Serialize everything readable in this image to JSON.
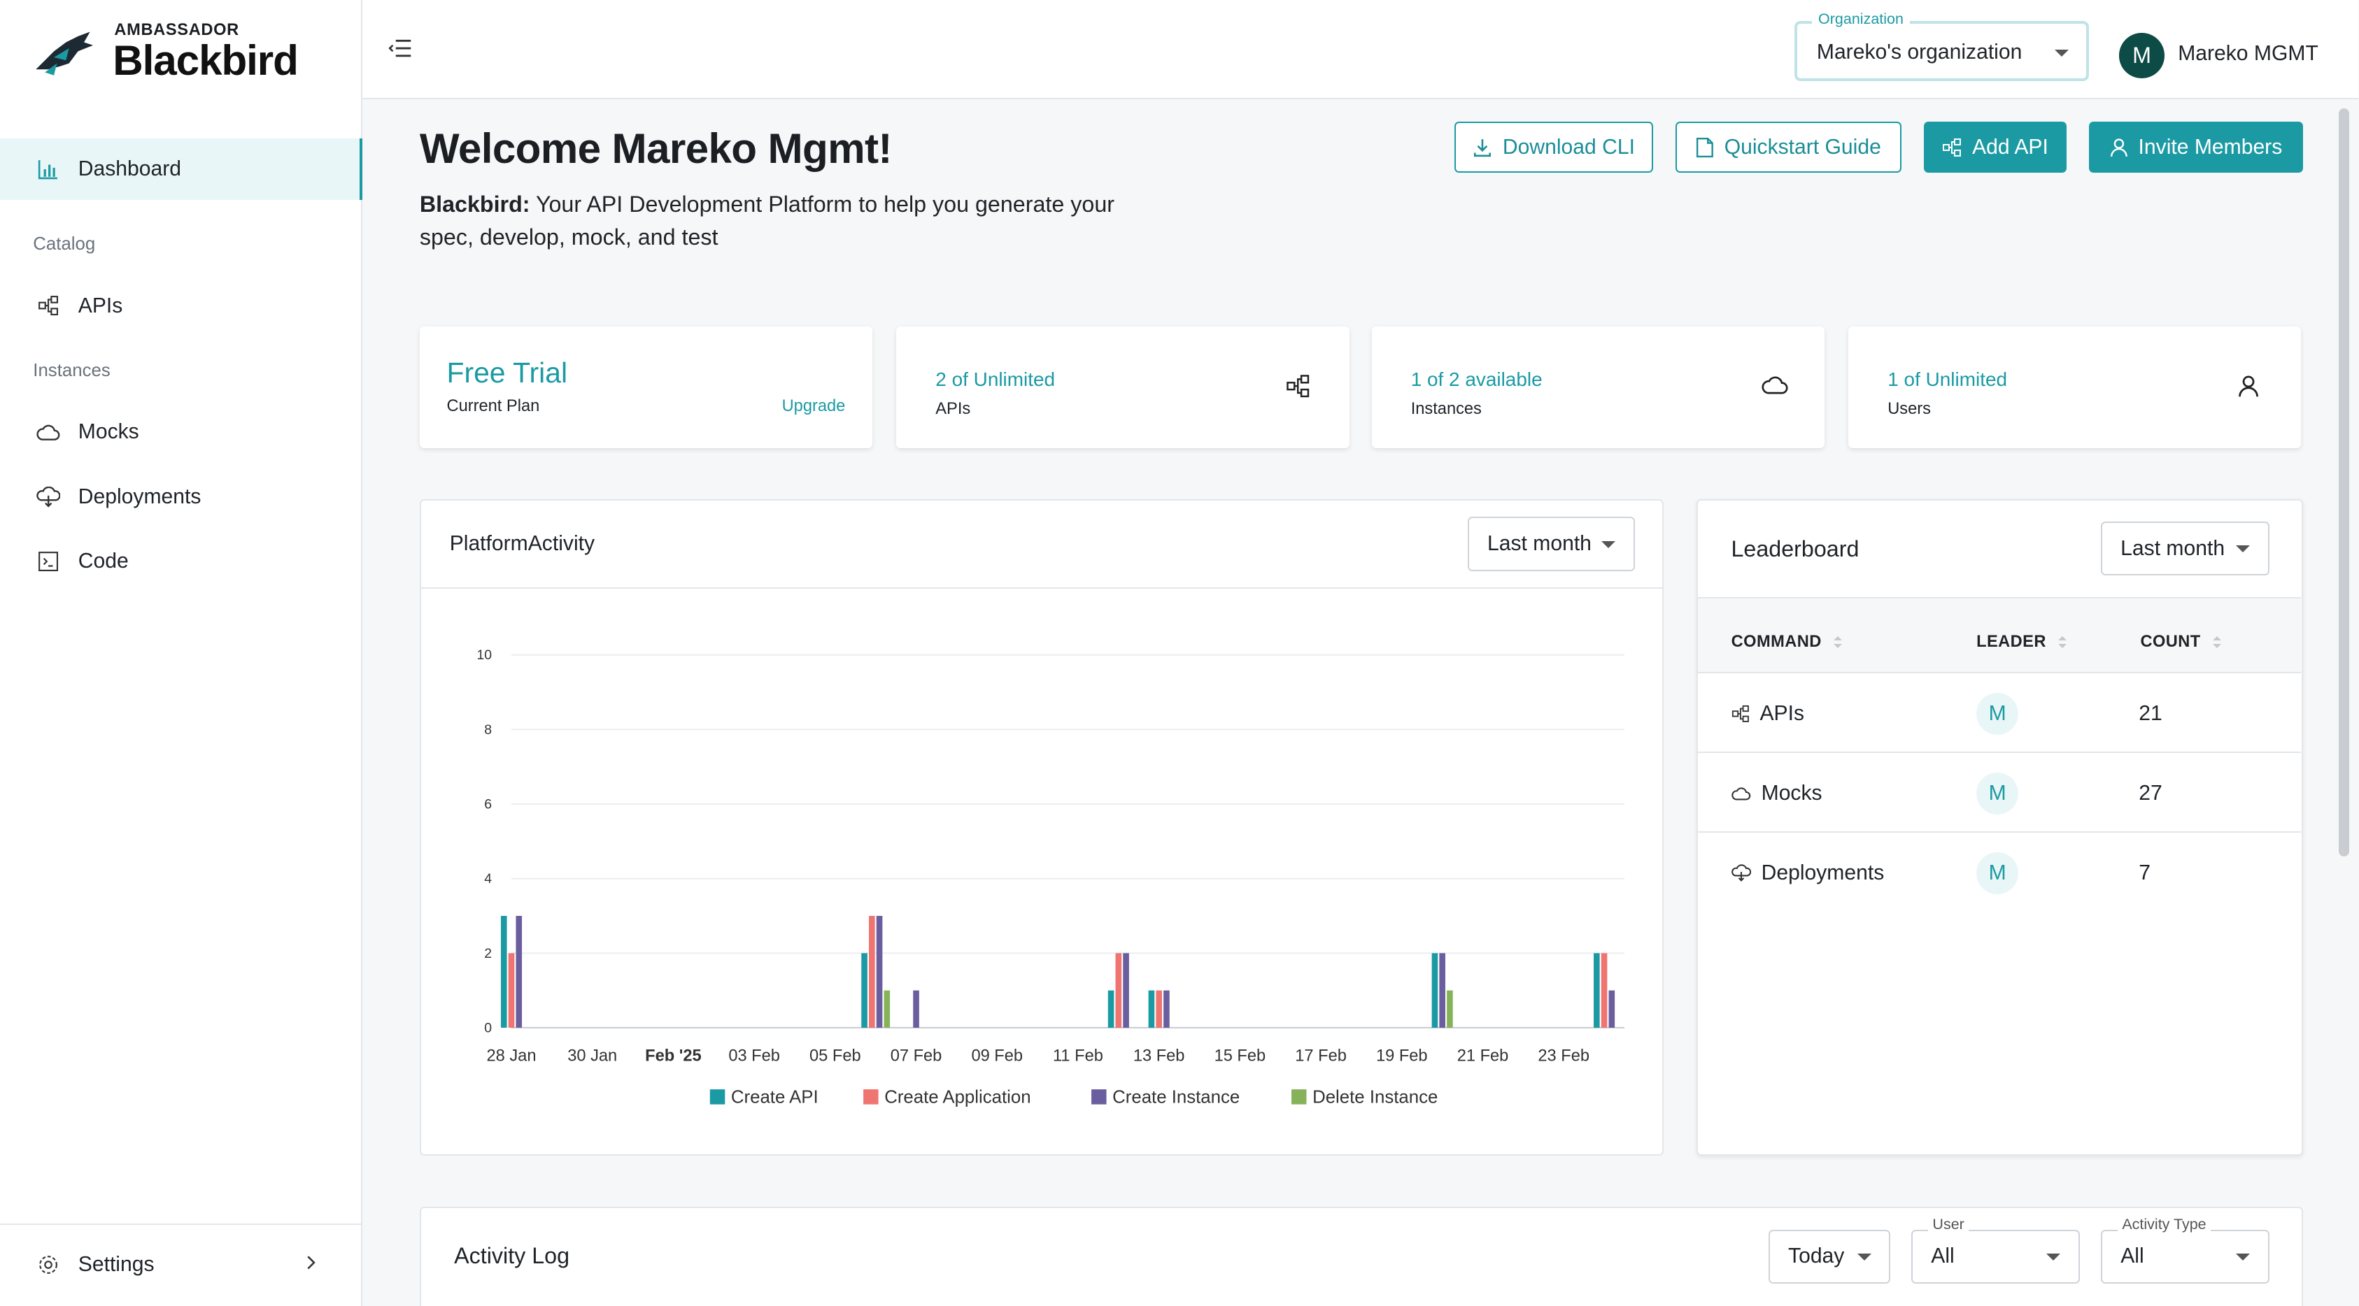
{
  "brand": {
    "top": "AMBASSADOR",
    "name": "Blackbird"
  },
  "sidebar": {
    "items": [
      {
        "label": "Dashboard",
        "icon": "chart-icon",
        "active": true
      },
      {
        "label": "APIs",
        "icon": "api-icon"
      },
      {
        "label": "Mocks",
        "icon": "cloud-icon"
      },
      {
        "label": "Deployments",
        "icon": "deploy-icon"
      },
      {
        "label": "Code",
        "icon": "terminal-icon"
      }
    ],
    "sections": {
      "catalog": "Catalog",
      "instances": "Instances"
    },
    "settings": "Settings"
  },
  "header": {
    "org_legend": "Organization",
    "org_value": "Mareko's organization",
    "avatar_letter": "M",
    "user_name": "Mareko MGMT"
  },
  "main": {
    "welcome": "Welcome Mareko Mgmt!",
    "tagline_bold": "Blackbird:",
    "tagline_rest": " Your API Development Platform to help you generate your spec, develop, mock, and test",
    "buttons": {
      "download_cli": "Download CLI",
      "quickstart": "Quickstart Guide",
      "add_api": "Add API",
      "invite": "Invite Members"
    }
  },
  "stats": {
    "plan_value": "Free Trial",
    "plan_label": "Current Plan",
    "upgrade": "Upgrade",
    "apis_value": "2 of Unlimited",
    "apis_label": "APIs",
    "instances_value": "1 of 2 available",
    "instances_label": "Instances",
    "users_value": "1 of Unlimited",
    "users_label": "Users"
  },
  "activity": {
    "title": "PlatformActivity",
    "range": "Last month"
  },
  "chart_data": {
    "type": "bar",
    "x": [
      "28 Jan",
      "29 Jan",
      "30 Jan",
      "31 Jan",
      "Feb '25",
      "02 Feb",
      "03 Feb",
      "04 Feb",
      "05 Feb",
      "06 Feb",
      "07 Feb",
      "08 Feb",
      "09 Feb",
      "10 Feb",
      "11 Feb",
      "12 Feb",
      "13 Feb",
      "14 Feb",
      "15 Feb",
      "16 Feb",
      "17 Feb",
      "18 Feb",
      "19 Feb",
      "20 Feb",
      "21 Feb",
      "22 Feb",
      "23 Feb",
      "24 Feb"
    ],
    "tick_labels": [
      "28 Jan",
      "30 Jan",
      "Feb '25",
      "03 Feb",
      "05 Feb",
      "07 Feb",
      "09 Feb",
      "11 Feb",
      "13 Feb",
      "15 Feb",
      "17 Feb",
      "19 Feb",
      "21 Feb",
      "23 Feb"
    ],
    "series": [
      {
        "name": "Create API",
        "color": "#1b9aa3",
        "values": [
          3,
          0,
          0,
          0,
          0,
          0,
          0,
          0,
          0,
          2,
          0,
          0,
          0,
          0,
          0,
          1,
          1,
          0,
          0,
          0,
          0,
          0,
          0,
          2,
          0,
          0,
          0,
          2
        ]
      },
      {
        "name": "Create Application",
        "color": "#f07470",
        "values": [
          2,
          0,
          0,
          0,
          0,
          0,
          0,
          0,
          0,
          3,
          0,
          0,
          0,
          0,
          0,
          2,
          1,
          0,
          0,
          0,
          0,
          0,
          0,
          0,
          0,
          0,
          0,
          2
        ]
      },
      {
        "name": "Create Instance",
        "color": "#6b5e9e",
        "values": [
          3,
          0,
          0,
          0,
          0,
          0,
          0,
          0,
          0,
          3,
          1,
          0,
          0,
          0,
          0,
          2,
          1,
          0,
          0,
          0,
          0,
          0,
          0,
          2,
          0,
          0,
          0,
          1
        ]
      },
      {
        "name": "Delete Instance",
        "color": "#86b35a",
        "values": [
          0,
          0,
          0,
          0,
          0,
          0,
          0,
          0,
          0,
          1,
          0,
          0,
          0,
          0,
          0,
          0,
          0,
          0,
          0,
          0,
          0,
          0,
          0,
          1,
          0,
          0,
          0,
          0
        ]
      }
    ],
    "ylim": [
      0,
      10
    ],
    "yticks": [
      0,
      2,
      4,
      6,
      8,
      10
    ],
    "grid": true,
    "legend": "bottom"
  },
  "leaderboard": {
    "title": "Leaderboard",
    "range": "Last month",
    "headers": {
      "command": "COMMAND",
      "leader": "LEADER",
      "count": "COUNT"
    },
    "rows": [
      {
        "command": "APIs",
        "icon": "api-icon",
        "leader": "M",
        "count": "21"
      },
      {
        "command": "Mocks",
        "icon": "cloud-icon",
        "leader": "M",
        "count": "27"
      },
      {
        "command": "Deployments",
        "icon": "deploy-icon",
        "leader": "M",
        "count": "7"
      }
    ]
  },
  "activity_log": {
    "title": "Activity Log",
    "range": "Today",
    "user_legend": "User",
    "user_value": "All",
    "type_legend": "Activity Type",
    "type_value": "All"
  }
}
